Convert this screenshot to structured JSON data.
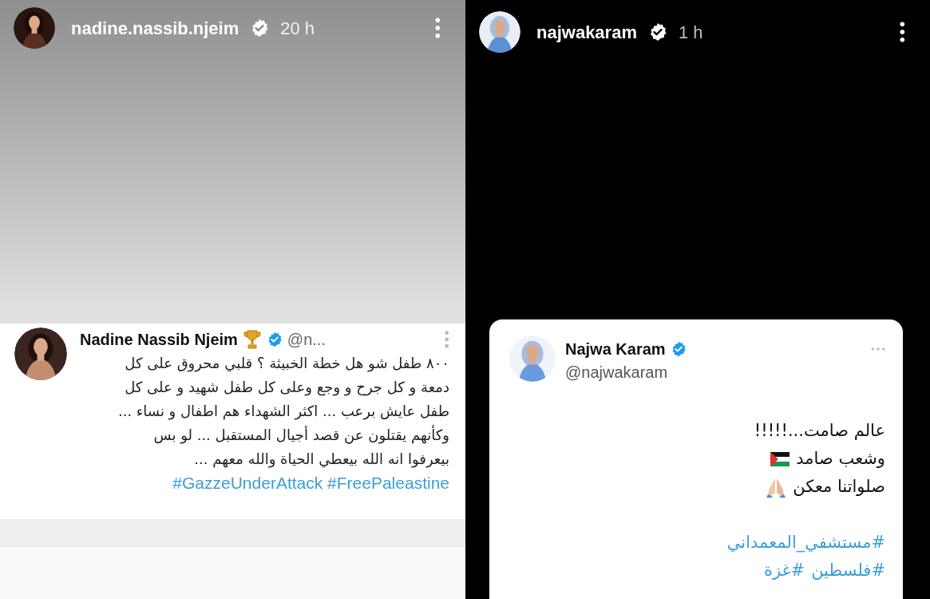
{
  "first_story": {
    "username": "nadine.nassib.njeim",
    "verified": true,
    "time": "20 h",
    "tweet": {
      "name": "Nadine Nassib Njeim",
      "verified": true,
      "handle": "@n...",
      "lines": [
        "٨٠٠ طفل شو هل خطة الخبيثة ؟ قلبي محروق على كل",
        "دمعة و كل جرح و وجع وعلى كل طفل شهيد و على كل",
        "طفل عايش برعب ... اكثر الشهداء هم اطفال و نساء ...",
        "وكأنهم يقتلون عن قصد أجيال المستقبل ... لو بس",
        "بيعرفوا انه الله بيعطي الحياة والله معهم ..."
      ],
      "hashtags": "#GazzeUnderAttack #FreePaleastine"
    }
  },
  "second_story": {
    "username": "najwakaram",
    "verified": true,
    "time": "1 h",
    "tweet": {
      "name": "Najwa Karam",
      "verified": true,
      "handle": "@najwakaram",
      "lines": [
        "عالم صامت...!!!!!",
        "وشعب صامد",
        "صلواتنا معكن"
      ],
      "hashtags": [
        "#مستشفي_المعمداني",
        "#فلسطين",
        "#غزة"
      ]
    }
  }
}
